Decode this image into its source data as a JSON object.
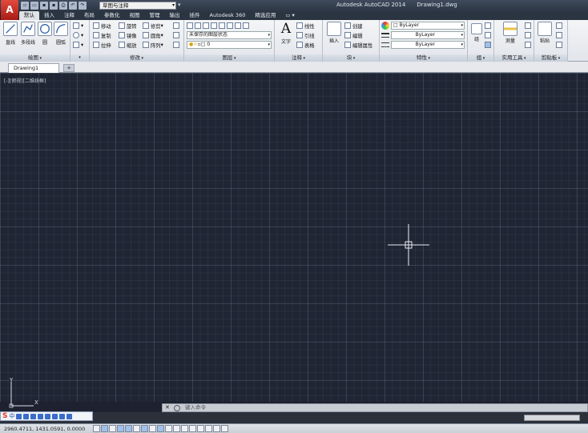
{
  "titlebar": {
    "app_button": "A",
    "workspace": "草图与注释",
    "app_name": "Autodesk AutoCAD 2014",
    "file_name": "Drawing1.dwg"
  },
  "tabs": [
    {
      "label": "默认",
      "active": true
    },
    {
      "label": "插入"
    },
    {
      "label": "注释"
    },
    {
      "label": "布局"
    },
    {
      "label": "参数化"
    },
    {
      "label": "视图"
    },
    {
      "label": "管理"
    },
    {
      "label": "输出"
    },
    {
      "label": "插件"
    },
    {
      "label": "Autodesk 360"
    },
    {
      "label": "精选应用"
    },
    {
      "label": "▭ ▾"
    }
  ],
  "ribbon": {
    "draw": {
      "label": "绘图",
      "line": "直线",
      "polyline": "多段线",
      "circle": "圆",
      "arc": "圆弧"
    },
    "modify": {
      "label": "修改",
      "move": "移动",
      "copy": "复制",
      "stretch": "拉伸",
      "rotate": "旋转",
      "mirror": "镜像",
      "scale": "缩放",
      "trim": "修剪",
      "fillet": "圆角",
      "array": "阵列"
    },
    "layers": {
      "label": "图层",
      "state": "未保存的图层状态",
      "current": "0"
    },
    "annotation": {
      "label": "注释",
      "text": "文字",
      "linear": "线性",
      "leader": "引线",
      "table": "表格"
    },
    "block": {
      "label": "块",
      "insert": "插入",
      "create": "创建",
      "edit": "编辑",
      "edit_attributes": "编辑属性"
    },
    "properties": {
      "label": "特性",
      "color": "ByLayer",
      "linetype": "ByLayer",
      "lineweight": "ByLayer"
    },
    "groups": {
      "label": "组",
      "group": "组"
    },
    "utilities": {
      "label": "实用工具",
      "measure": "测量"
    },
    "clipboard": {
      "label": "剪贴板",
      "paste": "粘贴"
    }
  },
  "document": {
    "tab": "Drawing1",
    "add": "+"
  },
  "viewport": {
    "label": "[-][俯视][二维线框]"
  },
  "ucs": {
    "x": "X",
    "y": "Y"
  },
  "command": {
    "placeholder": "键入命令",
    "close": "✕"
  },
  "ime": {
    "logo": "S",
    "mode": "中"
  },
  "status": {
    "coords": "2960.4711, 1431.0591, 0.0000"
  },
  "colors": {
    "canvas": "#1f2533",
    "titlebar": "#2c3644",
    "ribbon": "#e8eaee",
    "app_button": "#c8281e"
  }
}
